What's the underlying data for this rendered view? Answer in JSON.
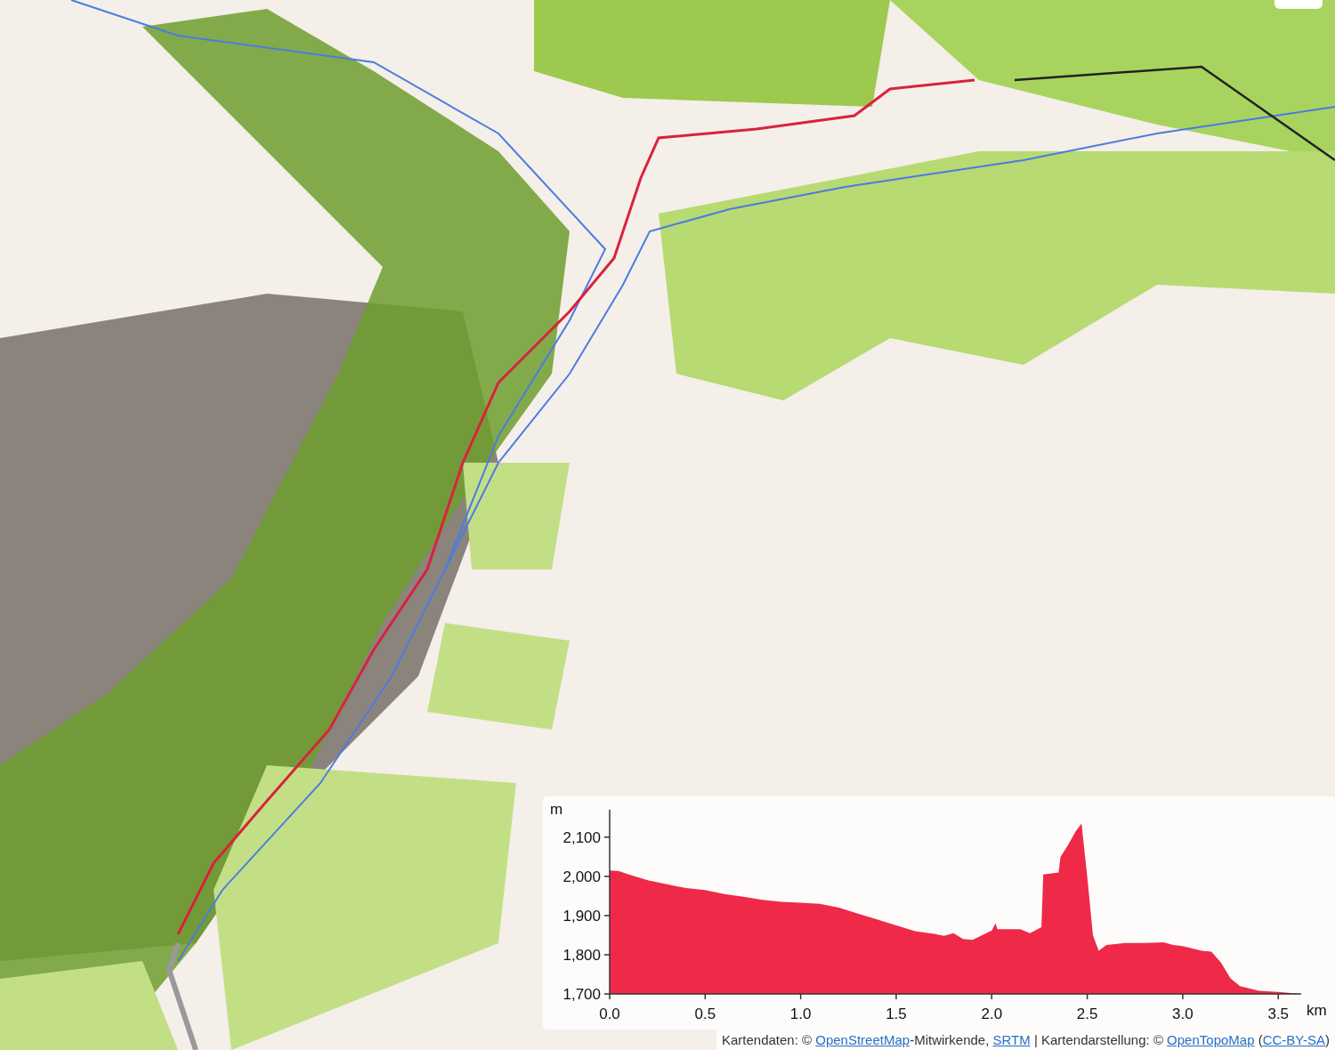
{
  "map": {
    "elevation_profile": {
      "chart_data": {
        "type": "area",
        "ylabel": "m",
        "xlabel": "km",
        "xlim": [
          0,
          3.62
        ],
        "ylim": [
          1700,
          2170
        ],
        "xticks": [
          {
            "value": 0,
            "label": "0.0"
          },
          {
            "value": 0.5,
            "label": "0.5"
          },
          {
            "value": 1,
            "label": "1.0"
          },
          {
            "value": 1.5,
            "label": "1.5"
          },
          {
            "value": 2,
            "label": "2.0"
          },
          {
            "value": 2.5,
            "label": "2.5"
          },
          {
            "value": 3,
            "label": "3.0"
          },
          {
            "value": 3.5,
            "label": "3.5"
          }
        ],
        "yticks": [
          {
            "value": 1700,
            "label": "1,700"
          },
          {
            "value": 1800,
            "label": "1,800"
          },
          {
            "value": 1900,
            "label": "1,900"
          },
          {
            "value": 2000,
            "label": "2,000"
          },
          {
            "value": 2100,
            "label": "2,100"
          }
        ],
        "x": [
          0,
          0.05,
          0.1,
          0.2,
          0.3,
          0.4,
          0.5,
          0.6,
          0.7,
          0.8,
          0.9,
          1.0,
          1.1,
          1.2,
          1.3,
          1.4,
          1.5,
          1.6,
          1.7,
          1.75,
          1.8,
          1.85,
          1.9,
          2.0,
          2.02,
          2.03,
          2.1,
          2.15,
          2.2,
          2.26,
          2.27,
          2.35,
          2.36,
          2.4,
          2.44,
          2.47,
          2.5,
          2.53,
          2.56,
          2.6,
          2.7,
          2.8,
          2.9,
          2.95,
          3.0,
          3.1,
          3.15,
          3.2,
          3.25,
          3.3,
          3.4,
          3.5,
          3.62
        ],
        "series": [
          {
            "color": "#ee2a48",
            "values": [
              2015,
              2013,
              2005,
              1990,
              1980,
              1970,
              1965,
              1955,
              1948,
              1940,
              1935,
              1933,
              1930,
              1920,
              1905,
              1890,
              1875,
              1860,
              1853,
              1848,
              1855,
              1840,
              1838,
              1862,
              1880,
              1865,
              1865,
              1865,
              1855,
              1870,
              2005,
              2010,
              2050,
              2080,
              2115,
              2135,
              2000,
              1850,
              1810,
              1825,
              1830,
              1830,
              1832,
              1825,
              1822,
              1810,
              1808,
              1780,
              1740,
              1720,
              1708,
              1705,
              1700
            ]
          }
        ]
      }
    },
    "attribution": [
      {
        "text": "Kartendaten: © ",
        "link": false
      },
      {
        "text": "OpenStreetMap",
        "link": true
      },
      {
        "text": "-Mitwirkende, ",
        "link": false
      },
      {
        "text": "SRTM",
        "link": true
      },
      {
        "text": " | Kartendarstellung: © ",
        "link": false
      },
      {
        "text": "OpenTopoMap",
        "link": true
      },
      {
        "text": " (",
        "link": false
      },
      {
        "text": "CC-BY-SA",
        "link": true
      },
      {
        "text": ")",
        "link": false
      }
    ]
  }
}
